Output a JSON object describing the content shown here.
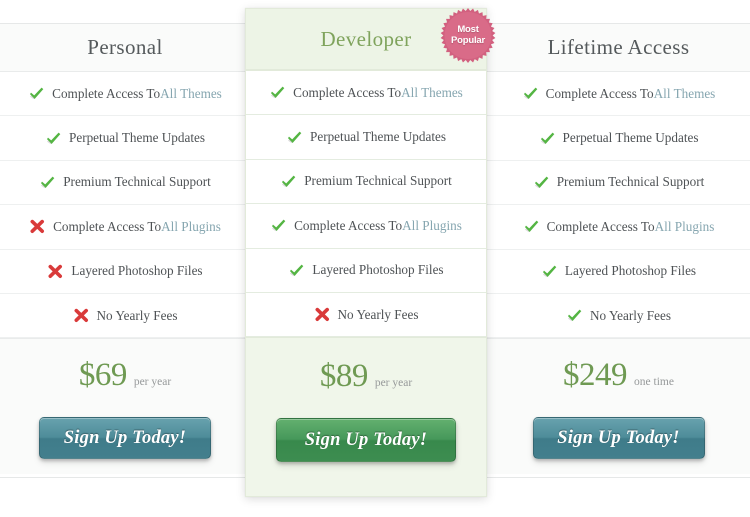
{
  "badge": {
    "line1": "Most",
    "line2": "Popular",
    "color": "#d2607f"
  },
  "colors": {
    "check": "#54b543",
    "cross": "#d93a3a",
    "accent_link": "#86a6b0",
    "price": "#6f9a53",
    "plan_title": "#555a5c",
    "plan_title_featured": "#7fa35c",
    "button_teal": "#4e8c99",
    "button_green": "#46985a",
    "featured_bg": "#f0f6ea"
  },
  "plans": [
    {
      "id": "personal",
      "title": "Personal",
      "featured": false,
      "features": [
        {
          "mark": "check-icon",
          "label": "Complete Access To ",
          "accent": "All Themes"
        },
        {
          "mark": "check-icon",
          "label": "Perpetual Theme Updates",
          "accent": ""
        },
        {
          "mark": "check-icon",
          "label": "Premium Technical Support",
          "accent": ""
        },
        {
          "mark": "cross-icon",
          "label": "Complete Access To ",
          "accent": "All Plugins"
        },
        {
          "mark": "cross-icon",
          "label": "Layered Photoshop Files",
          "accent": ""
        },
        {
          "mark": "cross-icon",
          "label": "No Yearly Fees",
          "accent": ""
        }
      ],
      "price": "$69",
      "period": "per year",
      "cta": "Sign Up Today!"
    },
    {
      "id": "developer",
      "title": "Developer",
      "featured": true,
      "features": [
        {
          "mark": "check-icon",
          "label": "Complete Access To ",
          "accent": "All Themes"
        },
        {
          "mark": "check-icon",
          "label": "Perpetual Theme Updates",
          "accent": ""
        },
        {
          "mark": "check-icon",
          "label": "Premium Technical Support",
          "accent": ""
        },
        {
          "mark": "check-icon",
          "label": "Complete Access To ",
          "accent": "All Plugins"
        },
        {
          "mark": "check-icon",
          "label": "Layered Photoshop Files",
          "accent": ""
        },
        {
          "mark": "cross-icon",
          "label": "No Yearly Fees",
          "accent": ""
        }
      ],
      "price": "$89",
      "period": "per year",
      "cta": "Sign Up Today!"
    },
    {
      "id": "lifetime",
      "title": "Lifetime Access",
      "featured": false,
      "features": [
        {
          "mark": "check-icon",
          "label": "Complete Access To ",
          "accent": "All Themes"
        },
        {
          "mark": "check-icon",
          "label": "Perpetual Theme Updates",
          "accent": ""
        },
        {
          "mark": "check-icon",
          "label": "Premium Technical Support",
          "accent": ""
        },
        {
          "mark": "check-icon",
          "label": "Complete Access To ",
          "accent": "All Plugins"
        },
        {
          "mark": "check-icon",
          "label": "Layered Photoshop Files",
          "accent": ""
        },
        {
          "mark": "check-icon",
          "label": "No Yearly Fees",
          "accent": ""
        }
      ],
      "price": "$249",
      "period": "one time",
      "cta": "Sign Up Today!"
    }
  ]
}
